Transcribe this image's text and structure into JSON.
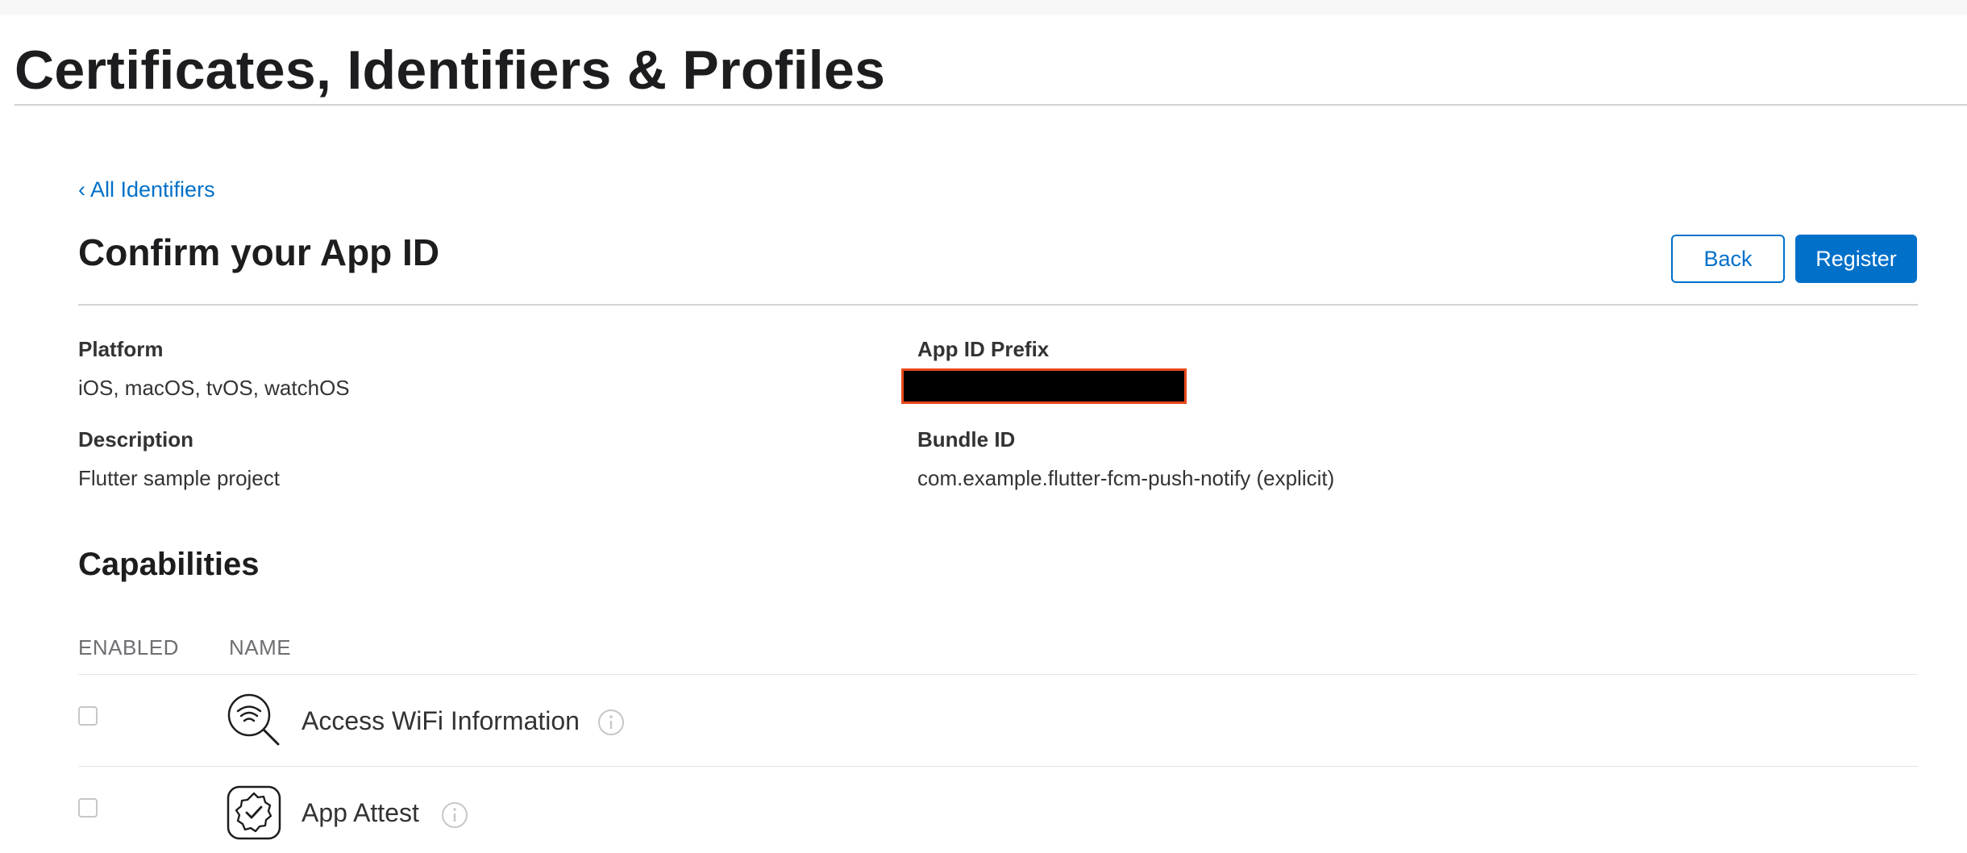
{
  "header": {
    "title": "Certificates, Identifiers & Profiles"
  },
  "nav": {
    "back_link": "All Identifiers",
    "back_chevron": "‹"
  },
  "page": {
    "title": "Confirm your App ID",
    "back_button": "Back",
    "register_button": "Register"
  },
  "details": {
    "platform_label": "Platform",
    "platform_value": "iOS, macOS, tvOS, watchOS",
    "description_label": "Description",
    "description_value": "Flutter sample project",
    "prefix_label": "App ID Prefix",
    "bundle_label": "Bundle ID",
    "bundle_value": "com.example.flutter-fcm-push-notify (explicit)"
  },
  "capabilities": {
    "title": "Capabilities",
    "col_enabled": "ENABLED",
    "col_name": "NAME",
    "items": [
      {
        "name": "Access WiFi Information",
        "icon": "wifi-search-icon",
        "enabled": false
      },
      {
        "name": "App Attest",
        "icon": "badge-check-icon",
        "enabled": false
      }
    ]
  },
  "colors": {
    "accent": "#0070c9",
    "redaction_border": "#e8491d",
    "text": "#1d1d1f"
  }
}
